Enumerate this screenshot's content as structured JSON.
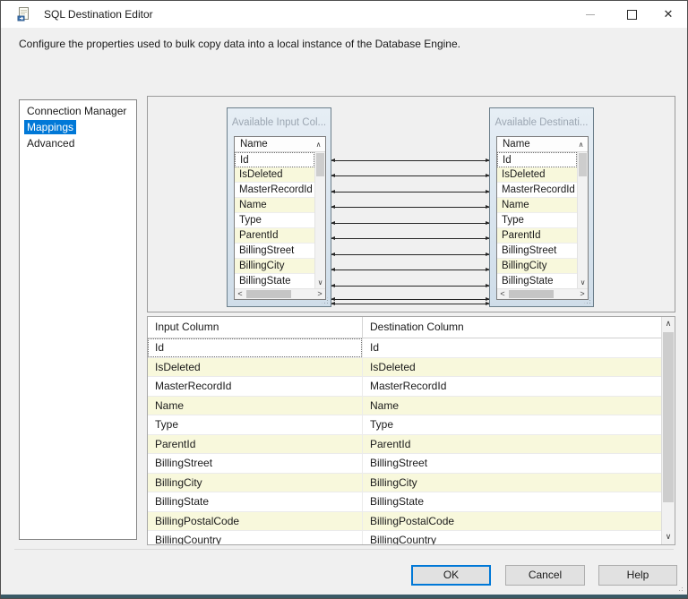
{
  "window": {
    "title": "SQL Destination Editor",
    "controls": {
      "minimize": "minimize",
      "maximize": "maximize",
      "close": "✕"
    }
  },
  "header": {
    "description": "Configure the properties used to bulk copy data into a local instance of the Database Engine."
  },
  "sidebar": {
    "items": [
      {
        "label": "Connection Manager"
      },
      {
        "label": "Mappings"
      },
      {
        "label": "Advanced"
      }
    ],
    "selected": "Mappings"
  },
  "mapping": {
    "input_box": {
      "title": "Available Input Col...",
      "column_header": "Name",
      "rows": [
        "Id",
        "IsDeleted",
        "MasterRecordId",
        "Name",
        "Type",
        "ParentId",
        "BillingStreet",
        "BillingCity",
        "BillingState"
      ]
    },
    "destination_box": {
      "title": "Available Destinati...",
      "column_header": "Name",
      "rows": [
        "Id",
        "IsDeleted",
        "MasterRecordId",
        "Name",
        "Type",
        "ParentId",
        "BillingStreet",
        "BillingCity",
        "BillingState"
      ]
    },
    "connection_count": 11
  },
  "table": {
    "headers": [
      "Input Column",
      "Destination Column"
    ],
    "rows": [
      {
        "input": "Id",
        "destination": "Id"
      },
      {
        "input": "IsDeleted",
        "destination": "IsDeleted"
      },
      {
        "input": "MasterRecordId",
        "destination": "MasterRecordId"
      },
      {
        "input": "Name",
        "destination": "Name"
      },
      {
        "input": "Type",
        "destination": "Type"
      },
      {
        "input": "ParentId",
        "destination": "ParentId"
      },
      {
        "input": "BillingStreet",
        "destination": "BillingStreet"
      },
      {
        "input": "BillingCity",
        "destination": "BillingCity"
      },
      {
        "input": "BillingState",
        "destination": "BillingState"
      },
      {
        "input": "BillingPostalCode",
        "destination": "BillingPostalCode"
      },
      {
        "input": "BillingCountry",
        "destination": "BillingCountry"
      }
    ]
  },
  "footer": {
    "ok_label": "OK",
    "cancel_label": "Cancel",
    "help_label": "Help"
  },
  "icons": {
    "scroll_up": "∧",
    "scroll_down": "∨",
    "scroll_left": "<",
    "scroll_right": ">",
    "close": "✕"
  },
  "colors": {
    "accent": "#0078d7",
    "alt_row": "#f8f8dc",
    "selection_bg": "#0078d7",
    "box_chrome": "#d7e2ec",
    "bottom_edge": "#3a5a66"
  }
}
